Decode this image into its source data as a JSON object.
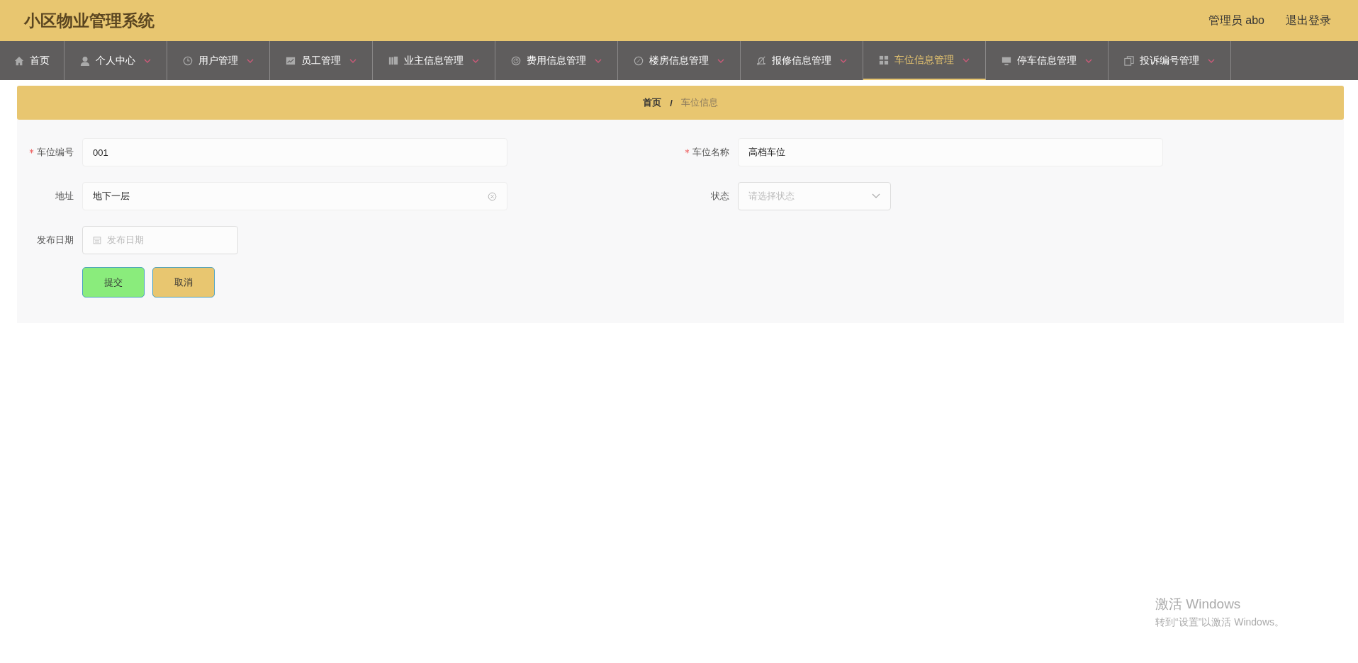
{
  "header": {
    "title": "小区物业管理系统",
    "user": "管理员 abo",
    "logout": "退出登录"
  },
  "nav": [
    {
      "label": "首页",
      "dropdown": false,
      "selected": false
    },
    {
      "label": "个人中心",
      "dropdown": true,
      "selected": false
    },
    {
      "label": "用户管理",
      "dropdown": true,
      "selected": false
    },
    {
      "label": "员工管理",
      "dropdown": true,
      "selected": false
    },
    {
      "label": "业主信息管理",
      "dropdown": true,
      "selected": false
    },
    {
      "label": "费用信息管理",
      "dropdown": true,
      "selected": false
    },
    {
      "label": "楼房信息管理",
      "dropdown": true,
      "selected": false
    },
    {
      "label": "报修信息管理",
      "dropdown": true,
      "selected": false
    },
    {
      "label": "车位信息管理",
      "dropdown": true,
      "selected": true
    },
    {
      "label": "停车信息管理",
      "dropdown": true,
      "selected": false
    },
    {
      "label": "投诉编号管理",
      "dropdown": true,
      "selected": false
    }
  ],
  "breadcrumb": {
    "separator": "/",
    "items": [
      "首页",
      "车位信息"
    ]
  },
  "form": {
    "rows": [
      [
        {
          "kind": "text",
          "label": "车位编号",
          "required": true,
          "value": "001",
          "clearable": false
        },
        {
          "kind": "text",
          "label": "车位名称",
          "required": true,
          "value": "高档车位",
          "clearable": false
        }
      ],
      [
        {
          "kind": "text",
          "label": "地址",
          "required": false,
          "value": "地下一层",
          "clearable": true
        },
        {
          "kind": "select",
          "label": "状态",
          "required": false,
          "placeholder": "请选择状态"
        }
      ],
      [
        {
          "kind": "date",
          "label": "发布日期",
          "required": false,
          "placeholder": "发布日期"
        }
      ]
    ],
    "buttons": [
      {
        "kind": "submit",
        "label": "提交"
      },
      {
        "kind": "cancel",
        "label": "取消"
      }
    ]
  },
  "os_notice": {
    "title": "激活 Windows",
    "text": "转到“设置”以激活 Windows。"
  }
}
